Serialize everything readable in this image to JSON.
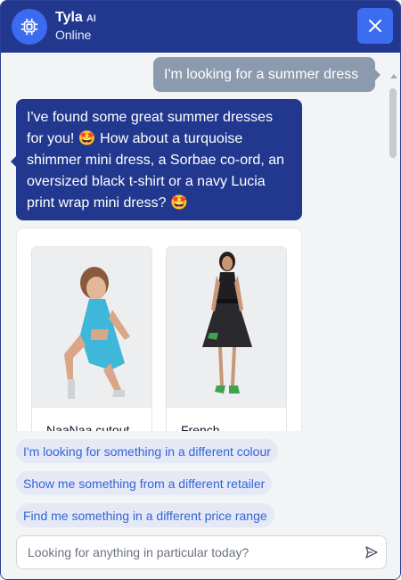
{
  "header": {
    "title": "Tyla",
    "badge": "AI",
    "status": "Online",
    "avatar_icon": "chip-icon",
    "close_icon": "close-icon",
    "accent": "#22388f"
  },
  "messages": {
    "user_text": "I'm looking for a summer dress",
    "bot_text": "I've found some great summer dresses for you! 🤩 How about a turquoise shimmer mini dress, a Sorbae co-ord, an oversized black t-shirt or a navy Lucia print wrap mini dress? 🤩"
  },
  "products": [
    {
      "name": "NaaNaa cutout"
    },
    {
      "name": "French"
    }
  ],
  "suggestions": [
    "I'm looking for something in a different colour",
    "Show me something from a different retailer",
    "Find me something in a different price range"
  ],
  "composer": {
    "placeholder": "Looking for anything in particular today?",
    "send_icon": "send-icon"
  }
}
